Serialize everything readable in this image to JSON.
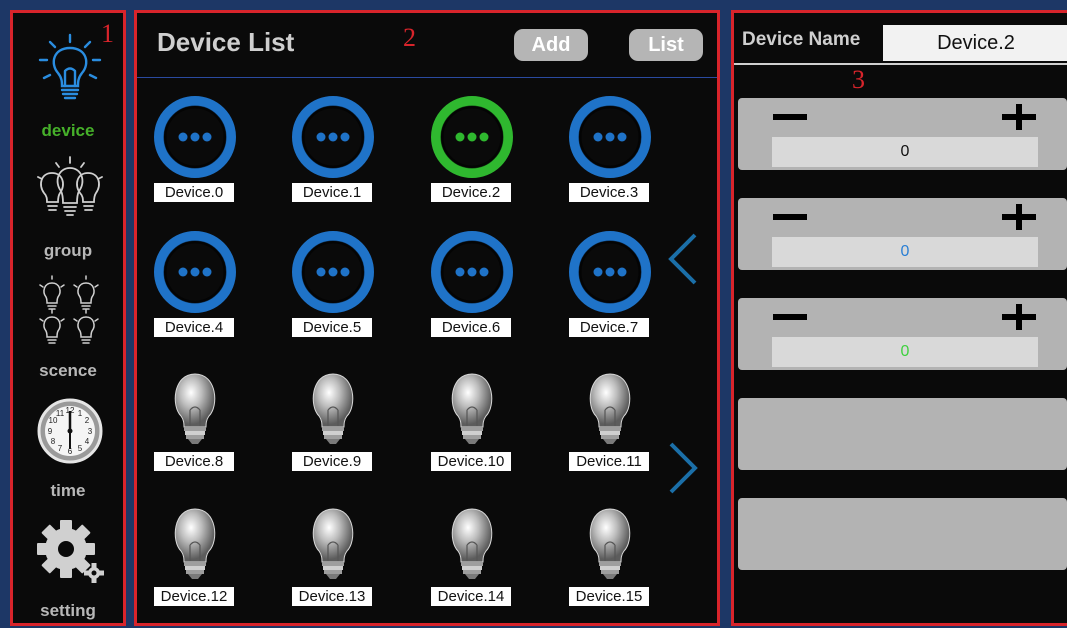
{
  "colors": {
    "active_green": "#46b02a",
    "ring_blue": "#1f73c8",
    "ring_green": "#2fb82f",
    "panel_border_red": "#d8242b",
    "arrow_blue": "#1b6fa8",
    "value_blue": "#2a7fd4",
    "value_green": "#3fd13f"
  },
  "sidebar": {
    "number": "1",
    "items": [
      {
        "label": "device",
        "icon": "bulb-glowing-icon",
        "active": true
      },
      {
        "label": "group",
        "icon": "bulb-group-icon"
      },
      {
        "label": "scence",
        "icon": "bulb-scene-icon"
      },
      {
        "label": "time",
        "icon": "clock-icon"
      },
      {
        "label": "setting",
        "icon": "gear-icon"
      }
    ]
  },
  "device_list": {
    "number": "2",
    "title": "Device List",
    "add_label": "Add",
    "list_label": "List",
    "prev_icon": "chevron-left-icon",
    "next_icon": "chevron-right-icon",
    "devices": [
      {
        "label": "Device.0",
        "icon": "ring-blue"
      },
      {
        "label": "Device.1",
        "icon": "ring-blue"
      },
      {
        "label": "Device.2",
        "icon": "ring-green",
        "selected": true
      },
      {
        "label": "Device.3",
        "icon": "ring-blue"
      },
      {
        "label": "Device.4",
        "icon": "ring-blue"
      },
      {
        "label": "Device.5",
        "icon": "ring-blue"
      },
      {
        "label": "Device.6",
        "icon": "ring-blue"
      },
      {
        "label": "Device.7",
        "icon": "ring-blue"
      },
      {
        "label": "Device.8",
        "icon": "lightbulb"
      },
      {
        "label": "Device.9",
        "icon": "lightbulb"
      },
      {
        "label": "Device.10",
        "icon": "lightbulb"
      },
      {
        "label": "Device.11",
        "icon": "lightbulb"
      },
      {
        "label": "Device.12",
        "icon": "lightbulb"
      },
      {
        "label": "Device.13",
        "icon": "lightbulb"
      },
      {
        "label": "Device.14",
        "icon": "lightbulb"
      },
      {
        "label": "Device.15",
        "icon": "lightbulb"
      }
    ]
  },
  "detail": {
    "number": "3",
    "name_label": "Device Name",
    "name_value": "Device.2",
    "controls": [
      {
        "value": "0",
        "color": "#111111"
      },
      {
        "value": "0",
        "color": "#2a7fd4"
      },
      {
        "value": "0",
        "color": "#3fd13f"
      },
      {
        "value": null
      },
      {
        "value": null
      }
    ]
  }
}
